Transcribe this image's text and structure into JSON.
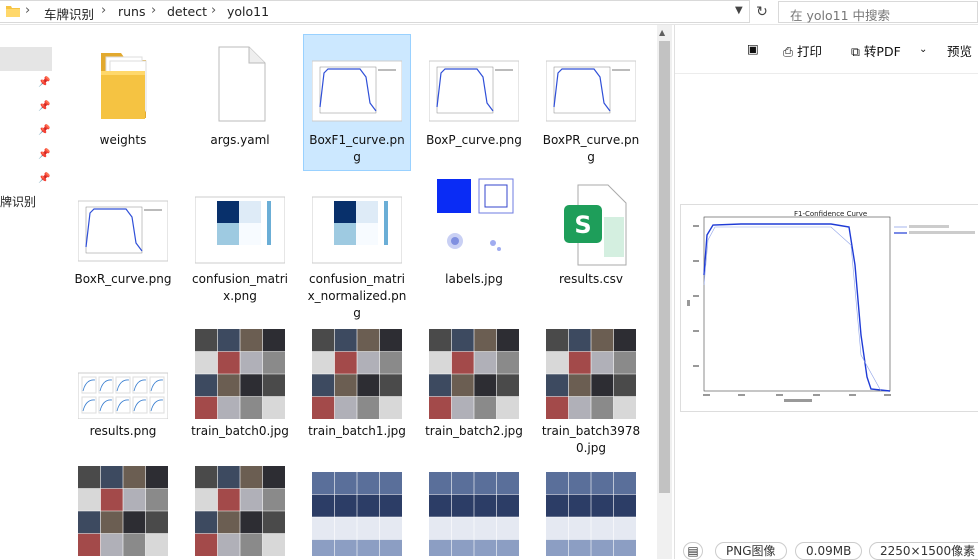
{
  "address": {
    "breadcrumbs": [
      "车牌识别",
      "runs",
      "detect",
      "yolo11"
    ],
    "search_placeholder": "在 yolo11 中搜索"
  },
  "nav": {
    "partial_label": "牌识别"
  },
  "files": [
    {
      "name": "weights",
      "kind": "folder"
    },
    {
      "name": "args.yaml",
      "kind": "file"
    },
    {
      "name": "BoxF1_curve.png",
      "kind": "curve",
      "selected": true
    },
    {
      "name": "BoxP_curve.png",
      "kind": "curve"
    },
    {
      "name": "BoxPR_curve.png",
      "kind": "curve"
    },
    {
      "name": "BoxR_curve.png",
      "kind": "curve"
    },
    {
      "name": "confusion_matrix.png",
      "kind": "matrix"
    },
    {
      "name": "confusion_matrix_normalized.png",
      "kind": "matrix"
    },
    {
      "name": "labels.jpg",
      "kind": "labels"
    },
    {
      "name": "results.csv",
      "kind": "csv"
    },
    {
      "name": "results.png",
      "kind": "results"
    },
    {
      "name": "train_batch0.jpg",
      "kind": "photos"
    },
    {
      "name": "train_batch1.jpg",
      "kind": "photos"
    },
    {
      "name": "train_batch2.jpg",
      "kind": "photos"
    },
    {
      "name": "train_batch39780.jpg",
      "kind": "photos"
    },
    {
      "name": "",
      "kind": "photos"
    },
    {
      "name": "",
      "kind": "photos"
    },
    {
      "name": "",
      "kind": "plates"
    },
    {
      "name": "",
      "kind": "plates"
    },
    {
      "name": "",
      "kind": "plates"
    }
  ],
  "preview": {
    "toolbar": {
      "print": "打印",
      "to_pdf": "转PDF",
      "preview": "预览"
    },
    "figure_title": "F1-Confidence Curve",
    "status": {
      "type": "PNG图像",
      "size": "0.09MB",
      "dimensions": "2250×1500像素"
    }
  },
  "colors": {
    "selection": "#cce8ff",
    "curve": "#1f3bd6",
    "folder": "#f5c342",
    "csv": "#1e9e5a"
  }
}
